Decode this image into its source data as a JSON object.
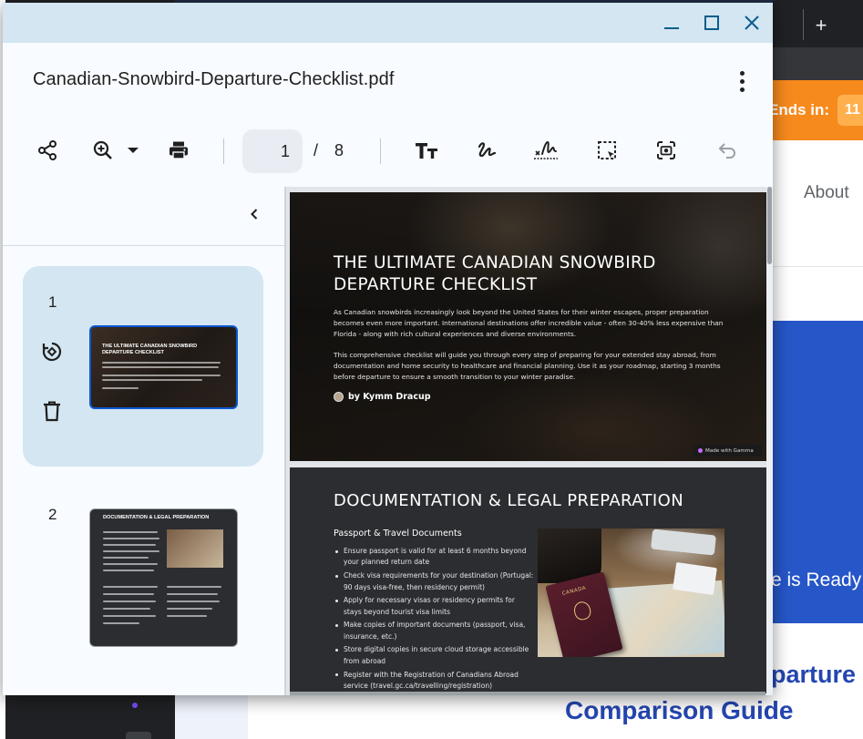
{
  "background": {
    "new_tab_label": "+",
    "promo_label": "Ends in:",
    "promo_timer": "11",
    "nav_about": "About",
    "hero_text": "e is Ready",
    "heading_line1": "parture",
    "heading_line2": "Comparison Guide"
  },
  "viewer": {
    "window_controls": [
      "minimize-icon",
      "maximize-icon",
      "close-icon"
    ],
    "file_name": "Canadian-Snowbird-Departure-Checklist.pdf",
    "current_page": "1",
    "page_separator": "/",
    "total_pages": "8",
    "toolbar_icons": [
      "share-icon",
      "zoom-in-icon",
      "zoom-dropdown-icon",
      "print-icon",
      "text-size-icon",
      "draw-icon",
      "signature-icon",
      "selection-icon",
      "screenshot-icon",
      "undo-icon"
    ],
    "accent_color": "#d3e6f1"
  },
  "sidebar": {
    "thumbnails": [
      {
        "number": "1",
        "title": "THE ULTIMATE CANADIAN SNOWBIRD DEPARTURE CHECKLIST",
        "actions": [
          "rotate-icon",
          "delete-icon"
        ]
      },
      {
        "number": "2",
        "title": "DOCUMENTATION & LEGAL PREPARATION"
      }
    ]
  },
  "pages": {
    "page1": {
      "title": "THE ULTIMATE CANADIAN SNOWBIRD DEPARTURE CHECKLIST",
      "para1": "As Canadian snowbirds increasingly look beyond the United States for their winter escapes, proper preparation becomes even more important. International destinations offer incredible value - often 30-40% less expensive than Florida - along with rich cultural experiences and diverse environments.",
      "para2": "This comprehensive checklist will guide you through every step of preparing for your extended stay abroad, from documentation and home security to healthcare and financial planning. Use it as your roadmap, starting 3 months before departure to ensure a smooth transition to your winter paradise.",
      "author": "by Kymm Dracup",
      "badge": "Made with Gamma"
    },
    "page2": {
      "title": "DOCUMENTATION & LEGAL PREPARATION",
      "subtitle": "Passport & Travel Documents",
      "items": [
        "Ensure passport is valid for at least 6 months beyond your planned return date",
        "Check visa requirements for your destination (Portugal: 90 days visa-free, then residency permit)",
        "Apply for necessary visas or residency permits for stays beyond tourist visa limits",
        "Make copies of important documents (passport, visa, insurance, etc.)",
        "Store digital copies in secure cloud storage accessible from abroad",
        "Register with the Registration of Canadians Abroad service (travel.gc.ca/travelling/registration)"
      ],
      "photo_label": "CANADA"
    }
  }
}
